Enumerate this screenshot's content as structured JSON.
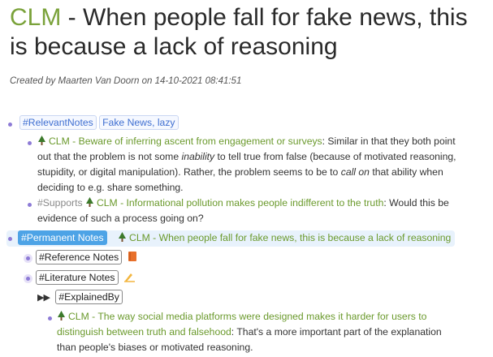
{
  "page": {
    "title_prefix": "CLM",
    "title_rest": " - When people fall for fake news, this is because a lack of reasoning",
    "byline": "Created by Maarten Van Doorn on 14-10-2021 08:41:51"
  },
  "blocks": {
    "relevant_tag": "#RelevantNotes",
    "relevant_tags": "Fake News, lazy",
    "note1_link": "CLM - Beware of inferring ascent from engagement or surveys",
    "note1_text_a": ": Similar in that they both point",
    "note1_line2_a": "out that the problem is not some ",
    "note1_line2_em": "inability",
    "note1_line2_b": " to tell true from false (because of motivated reasoning,",
    "note1_line3": "stupidity, or digital manipulation). Rather, the problem seems to be to ",
    "note1_line3_em": "call on",
    "note1_line3_b": " that ability when",
    "note1_line4": "deciding to e.g. share something.",
    "supports_tag": "#Supports",
    "note2_link": "CLM - Informational pollution makes people indifferent to the truth",
    "note2_text": ": Would this be",
    "note2_line2": "evidence of such a process going on?",
    "permanent_tag": "#Permanent Notes",
    "permanent_link": "CLM - When people fall for fake news, this is because a lack of reasoning",
    "reference_tag": "#Reference Notes",
    "literature_tag": "#Literature Notes",
    "explained_tag": "#ExplainedBy",
    "note3_link_line1": "CLM - The way social media platforms were designed makes it harder for users to",
    "note3_link_line2": "distinguish between truth and falsehood",
    "note3_text_a": ": That's a more important part of the explanation",
    "note3_line3": "than people's biases or motivated reasoning."
  },
  "colors": {
    "clm_green": "#7aa23a",
    "link_green": "#6b9a2d",
    "bullet_purple": "#8d7bd6",
    "tag_blue": "#3f6fd1",
    "permanent_bg": "#4da3e6"
  },
  "icons": [
    "tree-icon",
    "book-icon",
    "writing-hand-icon",
    "fast-forward-icon"
  ]
}
